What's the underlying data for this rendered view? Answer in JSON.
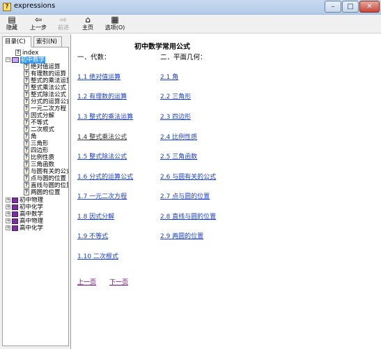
{
  "window": {
    "title": "expressions",
    "app_icon": "help-file-icon",
    "minimize": "–",
    "maximize": "□",
    "close": "✕"
  },
  "toolbar": {
    "hide": "隐藏",
    "back": "上一步",
    "forward": "前进",
    "home": "主页",
    "options": "选项(O)"
  },
  "nav": {
    "tabs": [
      "目录(C)",
      "索引(N)"
    ],
    "tree": {
      "index": "index",
      "junior_math": "初中数学",
      "children": [
        "绝对值运算",
        "有理数的运算",
        "整式的乘法运算",
        "整式乘法公式",
        "整式除法公式",
        "分式的运算公式",
        "一元二次方程",
        "因式分解",
        "不等式",
        "二次根式",
        "角",
        "三角形",
        "四边形",
        "比例性质",
        "三角函数",
        "与圆有关的公式",
        "点与圆的位置",
        "直线与圆的位置",
        "两圆的位置"
      ],
      "books": [
        "初中物理",
        "初中化学",
        "高中数学",
        "高中物理",
        "高中化学"
      ]
    }
  },
  "content": {
    "title": "初中数学常用公式",
    "algebra_heading": "一．代数：",
    "geometry_heading": "二．平面几何：",
    "algebra_links": [
      "1.1 绝对值运算",
      "1.2 有理数的运算",
      "1.3 整式的乘法运算",
      "1.4 整式乘法公式",
      "1.5 整式除法公式",
      "1.6 分式的运算公式",
      "1.7 一元二次方程",
      "1.8 因式分解",
      "1.9 不等式",
      "1.10 二次根式"
    ],
    "geometry_links": [
      "2.1 角",
      "2.2 三角形",
      "2.3 四边形",
      "2.4 比例性质",
      "2.5 三角函数",
      "2.6 与圆有关的公式",
      "2.7 点与圆的位置",
      "2.8 直线与圆的位置",
      "2.9 两圆的位置"
    ],
    "prev_page": "上一页",
    "next_page": "下一页"
  }
}
